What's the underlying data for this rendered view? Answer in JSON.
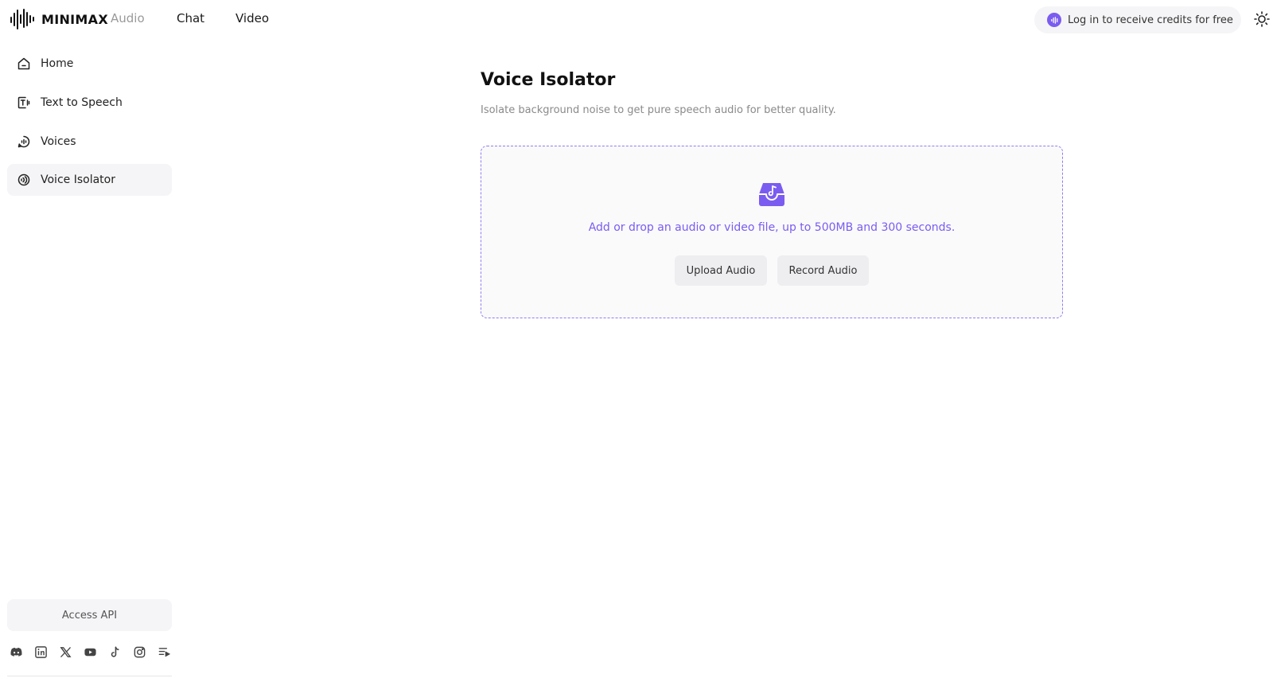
{
  "brand": {
    "name": "MINIMAX",
    "accent": "#7b5cf0",
    "icon": "waveform-logo-icon"
  },
  "topnav": {
    "audio": "Audio",
    "chat": "Chat",
    "video": "Video"
  },
  "login": {
    "label": "Log in to receive credits for free",
    "icon": "audio-wave-icon"
  },
  "theme_toggle": {
    "icon": "sun-icon"
  },
  "sidebar": {
    "items": [
      {
        "label": "Home",
        "icon": "home-icon",
        "active": false
      },
      {
        "label": "Text to Speech",
        "icon": "text-to-speech-icon",
        "active": false
      },
      {
        "label": "Voices",
        "icon": "voices-icon",
        "active": false
      },
      {
        "label": "Voice Isolator",
        "icon": "voice-isolator-icon",
        "active": true
      }
    ],
    "access_api": "Access API",
    "socials": [
      "discord-icon",
      "linkedin-icon",
      "x-icon",
      "youtube-icon",
      "tiktok-icon",
      "instagram-icon",
      "playlist-icon"
    ]
  },
  "main": {
    "title": "Voice Isolator",
    "subtitle": "Isolate background noise to get pure speech audio for better quality.",
    "dropzone": {
      "icon": "audio-inbox-icon",
      "text": "Add or drop an audio or video file, up to 500MB and 300 seconds.",
      "upload_label": "Upload Audio",
      "record_label": "Record Audio"
    }
  }
}
